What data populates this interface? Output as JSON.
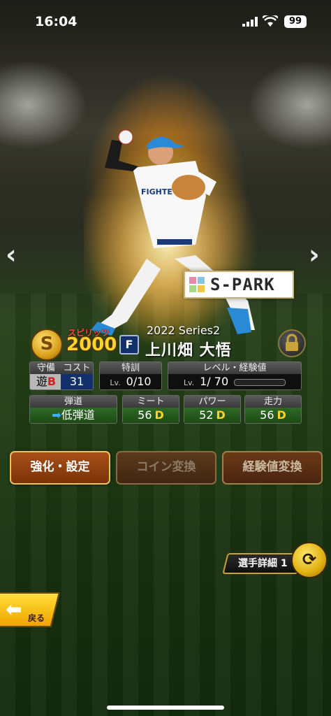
{
  "status_bar": {
    "time": "16:04",
    "battery": "99"
  },
  "card": {
    "spirits_label": "スピリッツ",
    "spirits_value": "2000",
    "spirits_icon": "S",
    "team_badge": "F",
    "series": "2022 Series2",
    "player_name": "上川畑 大悟",
    "brand_logo": "S-PARK"
  },
  "stats": {
    "position": {
      "label": "守備",
      "value": "遊",
      "grade": "B"
    },
    "cost": {
      "label": "コスト",
      "value": "31"
    },
    "training": {
      "label": "特訓",
      "lv": "Lv.",
      "value": "0/10"
    },
    "level": {
      "label": "レベル・経験値",
      "lv": "Lv.",
      "value": "1/ 70",
      "exp_fraction": 0
    },
    "trajectory": {
      "label": "弾道",
      "value": "低弾道"
    },
    "meet": {
      "label": "ミート",
      "value": "56",
      "grade": "D"
    },
    "power": {
      "label": "パワー",
      "value": "52",
      "grade": "D"
    },
    "speed": {
      "label": "走力",
      "value": "56",
      "grade": "D"
    }
  },
  "buttons": {
    "strengthen": "強化・設定",
    "coin_convert": "コイン変換",
    "exp_convert": "経験値変換",
    "player_detail": "選手詳細 1",
    "back": "戻る"
  },
  "colors": {
    "accent_gold": "#ffd42a",
    "button_brown": "#a8501a",
    "stat_green": "#2e6a26"
  }
}
